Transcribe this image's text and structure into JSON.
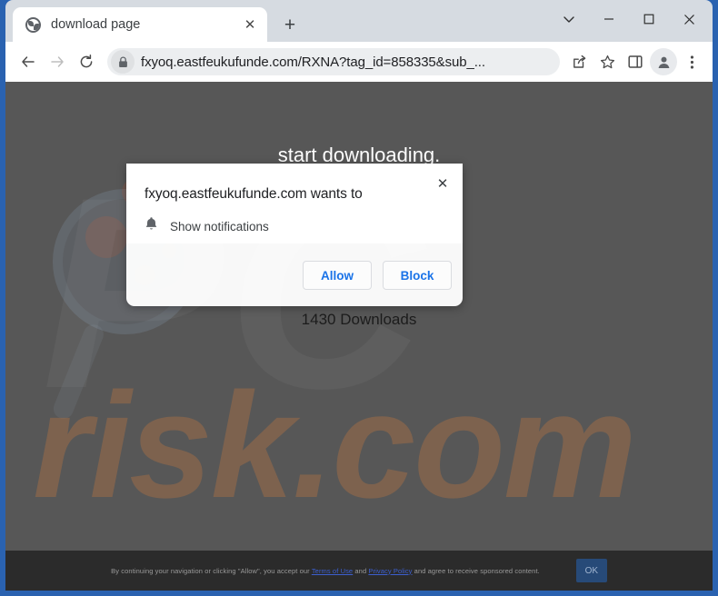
{
  "window": {
    "controls": [
      {
        "name": "tab-search",
        "icon": "chevron-down-icon"
      },
      {
        "name": "minimize",
        "icon": "minimize-icon"
      },
      {
        "name": "maximize",
        "icon": "maximize-icon"
      },
      {
        "name": "close",
        "icon": "close-icon"
      }
    ]
  },
  "tab": {
    "title": "download page",
    "favicon": "globe-icon",
    "close_label": "✕",
    "newtab_label": "+"
  },
  "toolbar": {
    "back": "←",
    "forward": "→",
    "reload": "⟳",
    "url": "fxyoq.eastfeukufunde.com/RXNA?tag_id=858335&sub_...",
    "lock_icon": "lock-icon",
    "share_icon": "share-icon",
    "bookmark_icon": "star-icon",
    "sidepanel_icon": "side-panel-icon",
    "profile_icon": "avatar-icon",
    "menu_icon": "three-dot-menu-icon"
  },
  "page": {
    "heading": "start downloading.",
    "downloads": "1430 Downloads",
    "watermark_pc": "PC",
    "watermark_risk": "risk.com"
  },
  "consent": {
    "text_before": "By continuing your navigation or clicking \"Allow\", you accept our ",
    "link1": "Terms of Use",
    "text_middle": " and ",
    "link2": "Privacy Policy",
    "text_after": " and agree to receive sponsored content.",
    "ok_label": "OK"
  },
  "permission_dialog": {
    "title": "fxyoq.eastfeukufunde.com wants to",
    "permission_label": "Show notifications",
    "permission_icon": "bell-icon",
    "allow_label": "Allow",
    "block_label": "Block",
    "close_label": "✕"
  },
  "colors": {
    "window_frame": "#2a62b0",
    "tabstrip": "#d6dbe1",
    "page_background": "#575757",
    "consent_bar": "#2b2b2b",
    "accent_blue": "#1a73e8",
    "watermark_orange": "#d67e3a"
  }
}
